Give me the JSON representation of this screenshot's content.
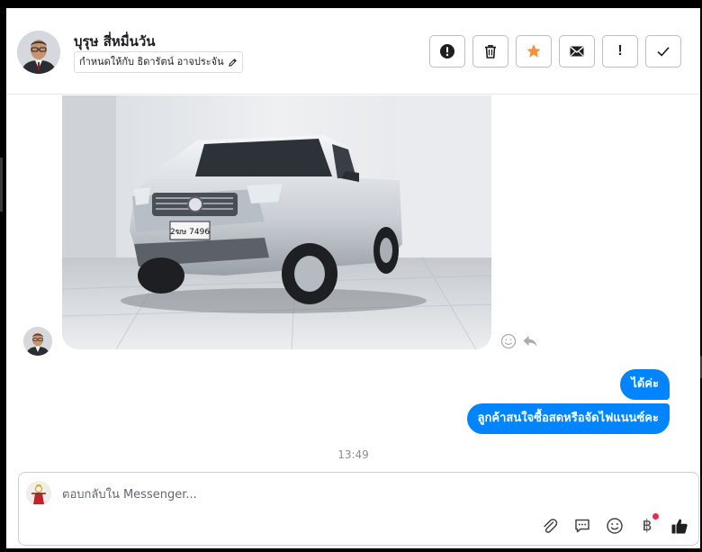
{
  "header": {
    "contact_name": "บุรุษ สี่หมื่นวัน",
    "assign_label": "กำหนดให้กับ ธิดารัตน์ อาจประจัน",
    "tools": [
      {
        "name": "alert-circle-icon",
        "label": "Mark as spam"
      },
      {
        "name": "trash-icon",
        "label": "Delete"
      },
      {
        "name": "star-icon",
        "label": "Star"
      },
      {
        "name": "envelope-icon",
        "label": "Mark as unread"
      },
      {
        "name": "exclamation-icon",
        "label": "Follow up"
      },
      {
        "name": "check-icon",
        "label": "Done"
      }
    ],
    "accent_star": "#f7923b"
  },
  "conversation": {
    "messages": [
      {
        "from": "me",
        "text": "ได้ค่ะ"
      },
      {
        "from": "me",
        "text": "ลูกค้าสนใจซื้อสดหรือจัดไฟแนนซ์คะ"
      }
    ],
    "timestamp": "13:49",
    "bubble_color": "#0084ff",
    "photo_plate": "2ฆษ 7496"
  },
  "composer": {
    "placeholder": "ตอบกลับใน Messenger...",
    "icons": [
      "paperclip-icon",
      "speech-bubble-icon",
      "emoji-icon",
      "baht-icon",
      "thumbs-up-icon"
    ],
    "baht_symbol": "฿"
  }
}
